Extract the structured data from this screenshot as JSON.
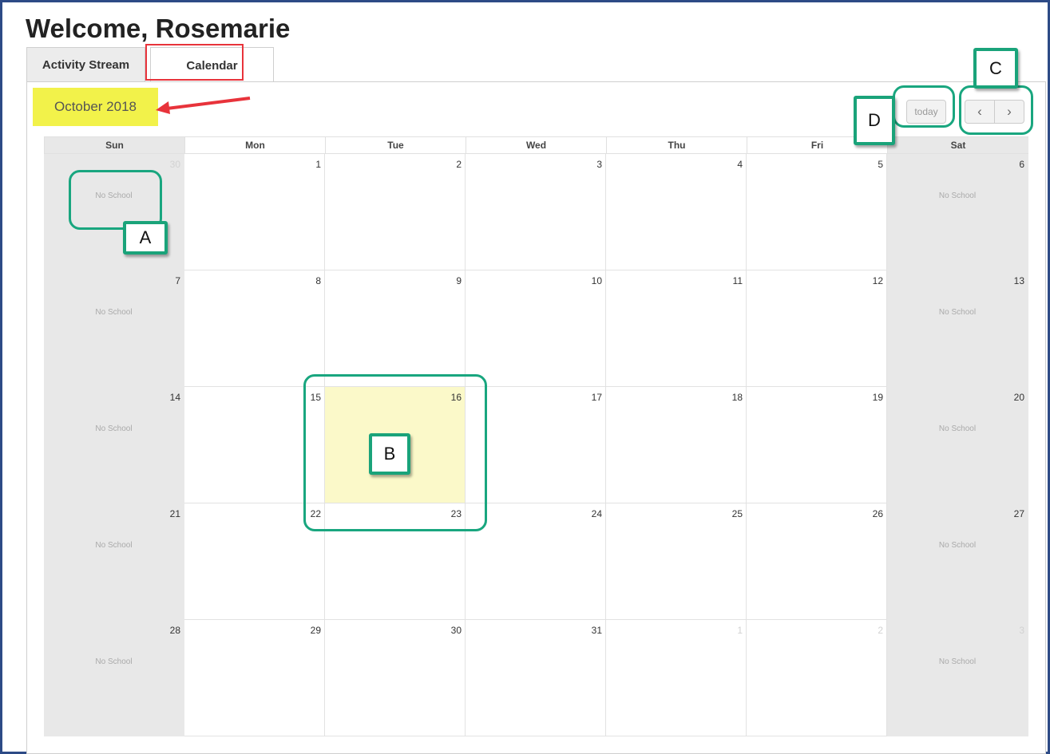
{
  "header": {
    "title": "Welcome, Rosemarie"
  },
  "tabs": [
    {
      "label": "Activity Stream",
      "active": false
    },
    {
      "label": "Calendar",
      "active": true
    }
  ],
  "calendar": {
    "month_title": "October 2018",
    "today_label": "today",
    "prev_icon": "chevron-left-icon",
    "next_icon": "chevron-right-icon",
    "day_headers": [
      "Sun",
      "Mon",
      "Tue",
      "Wed",
      "Thu",
      "Fri",
      "Sat"
    ],
    "weekend_event": "No School",
    "today_date": "16",
    "weeks": [
      [
        "30",
        "1",
        "2",
        "3",
        "4",
        "5",
        "6"
      ],
      [
        "7",
        "8",
        "9",
        "10",
        "11",
        "12",
        "13"
      ],
      [
        "14",
        "15",
        "16",
        "17",
        "18",
        "19",
        "20"
      ],
      [
        "21",
        "22",
        "23",
        "24",
        "25",
        "26",
        "27"
      ],
      [
        "28",
        "29",
        "30",
        "31",
        "1",
        "2",
        "3"
      ]
    ],
    "other_month": [
      [
        0
      ],
      [],
      [],
      [],
      [
        4,
        5,
        6
      ]
    ]
  },
  "annotations": {
    "a": "A",
    "b": "B",
    "c": "C",
    "d": "D",
    "highlight_color": "#f2f24a",
    "callout_color": "#19a67f",
    "arrow_color": "#e8333b"
  }
}
